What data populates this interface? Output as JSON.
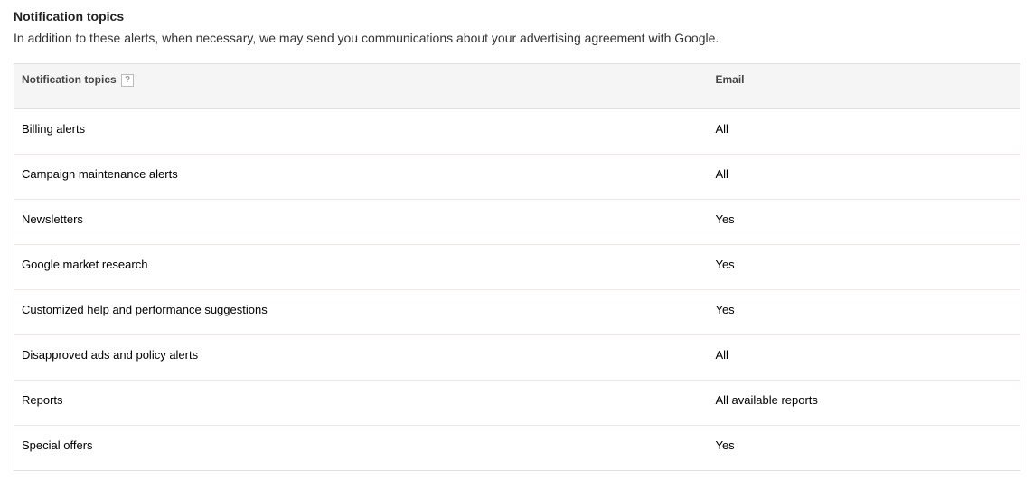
{
  "header": {
    "title": "Notification topics",
    "description": "In addition to these alerts, when necessary, we may send you communications about your advertising agreement with Google."
  },
  "table": {
    "columns": {
      "topics": "Notification topics",
      "email": "Email"
    },
    "help_icon": "?",
    "rows": [
      {
        "topic": "Billing alerts",
        "email": "All"
      },
      {
        "topic": "Campaign maintenance alerts",
        "email": "All"
      },
      {
        "topic": "Newsletters",
        "email": "Yes"
      },
      {
        "topic": "Google market research",
        "email": "Yes"
      },
      {
        "topic": "Customized help and performance suggestions",
        "email": "Yes"
      },
      {
        "topic": "Disapproved ads and policy alerts",
        "email": "All"
      },
      {
        "topic": "Reports",
        "email": "All available reports"
      },
      {
        "topic": "Special offers",
        "email": "Yes"
      }
    ]
  }
}
